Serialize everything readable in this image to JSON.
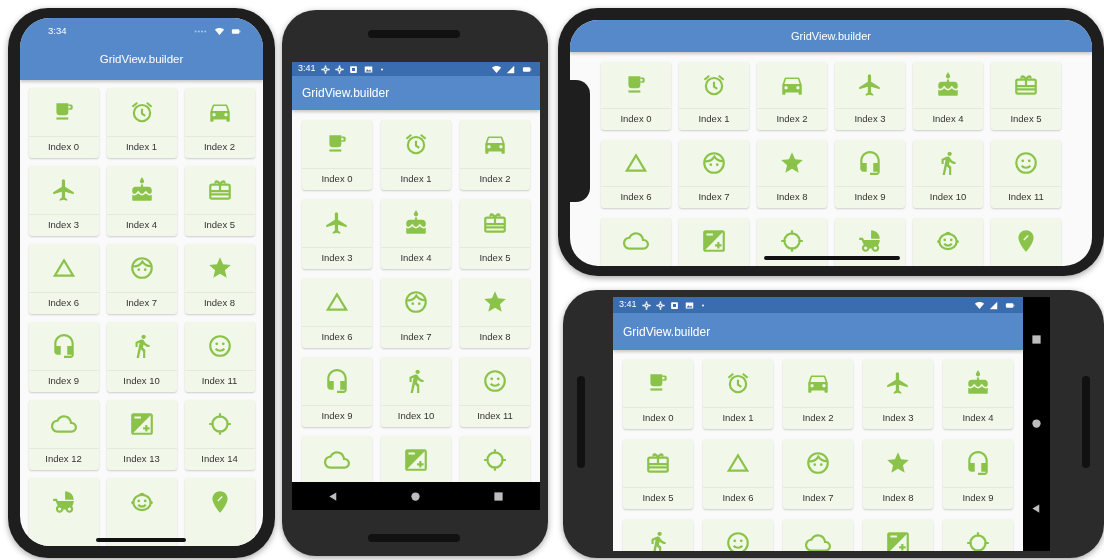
{
  "devices": [
    {
      "kind": "iphone-portrait",
      "status_bar": {
        "time": "3:34",
        "icons": [
          {
            "kind": "signal-dots"
          },
          {
            "kind": "wifi"
          },
          {
            "kind": "battery"
          }
        ]
      },
      "app_bar": {
        "title": "GridView.builder"
      },
      "tiles": [
        {
          "kind": "coffee",
          "label": "Index 0"
        },
        {
          "kind": "alarm",
          "label": "Index 1"
        },
        {
          "kind": "car",
          "label": "Index 2"
        },
        {
          "kind": "airplane",
          "label": "Index 3"
        },
        {
          "kind": "cake",
          "label": "Index 4"
        },
        {
          "kind": "gift",
          "label": "Index 5"
        },
        {
          "kind": "triangle",
          "label": "Index 6"
        },
        {
          "kind": "face",
          "label": "Index 7"
        },
        {
          "kind": "star",
          "label": "Index 8"
        },
        {
          "kind": "headset",
          "label": "Index 9"
        },
        {
          "kind": "walk",
          "label": "Index 10"
        },
        {
          "kind": "smiley",
          "label": "Index 11"
        },
        {
          "kind": "cloud",
          "label": "Index 12"
        },
        {
          "kind": "exposure",
          "label": "Index 13"
        },
        {
          "kind": "crosshair",
          "label": "Index 14"
        },
        {
          "kind": "stroller"
        },
        {
          "kind": "baby"
        },
        {
          "kind": "pin"
        }
      ]
    },
    {
      "kind": "android-portrait",
      "status_bar": {
        "time": "3:41",
        "icons": [
          {
            "kind": "gear"
          },
          {
            "kind": "gear"
          },
          {
            "kind": "square"
          },
          {
            "kind": "image"
          },
          {
            "kind": "dot"
          },
          {
            "kind": "spacer"
          },
          {
            "kind": "wifi"
          },
          {
            "kind": "signal"
          },
          {
            "kind": "battery"
          }
        ]
      },
      "app_bar": {
        "title": "GridView.builder"
      },
      "tiles": [
        {
          "kind": "coffee",
          "label": "Index 0"
        },
        {
          "kind": "alarm",
          "label": "Index 1"
        },
        {
          "kind": "car",
          "label": "Index 2"
        },
        {
          "kind": "airplane",
          "label": "Index 3"
        },
        {
          "kind": "cake",
          "label": "Index 4"
        },
        {
          "kind": "gift",
          "label": "Index 5"
        },
        {
          "kind": "triangle",
          "label": "Index 6"
        },
        {
          "kind": "face",
          "label": "Index 7"
        },
        {
          "kind": "star",
          "label": "Index 8"
        },
        {
          "kind": "headset",
          "label": "Index 9"
        },
        {
          "kind": "walk",
          "label": "Index 10"
        },
        {
          "kind": "smiley",
          "label": "Index 11"
        },
        {
          "kind": "cloud"
        },
        {
          "kind": "exposure"
        },
        {
          "kind": "crosshair"
        }
      ],
      "nav_bar": [
        {
          "kind": "back"
        },
        {
          "kind": "home"
        },
        {
          "kind": "recents"
        }
      ]
    },
    {
      "kind": "iphone-landscape",
      "app_bar": {
        "title": "GridView.builder"
      },
      "tiles": [
        {
          "kind": "coffee",
          "label": "Index 0"
        },
        {
          "kind": "alarm",
          "label": "Index 1"
        },
        {
          "kind": "car",
          "label": "Index 2"
        },
        {
          "kind": "airplane",
          "label": "Index 3"
        },
        {
          "kind": "cake",
          "label": "Index 4"
        },
        {
          "kind": "gift",
          "label": "Index 5"
        },
        {
          "kind": "triangle",
          "label": "Index 6"
        },
        {
          "kind": "face",
          "label": "Index 7"
        },
        {
          "kind": "star",
          "label": "Index 8"
        },
        {
          "kind": "headset",
          "label": "Index 9"
        },
        {
          "kind": "walk",
          "label": "Index 10"
        },
        {
          "kind": "smiley",
          "label": "Index 11"
        },
        {
          "kind": "cloud"
        },
        {
          "kind": "exposure"
        },
        {
          "kind": "crosshair"
        },
        {
          "kind": "stroller"
        },
        {
          "kind": "baby"
        },
        {
          "kind": "pin"
        }
      ]
    },
    {
      "kind": "android-landscape",
      "status_bar": {
        "time": "3:41",
        "icons": [
          {
            "kind": "gear"
          },
          {
            "kind": "gear"
          },
          {
            "kind": "square"
          },
          {
            "kind": "image"
          },
          {
            "kind": "dot"
          },
          {
            "kind": "spacer"
          },
          {
            "kind": "wifi"
          },
          {
            "kind": "signal"
          },
          {
            "kind": "battery"
          }
        ]
      },
      "app_bar": {
        "title": "GridView.builder"
      },
      "tiles": [
        {
          "kind": "coffee",
          "label": "Index 0"
        },
        {
          "kind": "alarm",
          "label": "Index 1"
        },
        {
          "kind": "car",
          "label": "Index 2"
        },
        {
          "kind": "airplane",
          "label": "Index 3"
        },
        {
          "kind": "cake",
          "label": "Index 4"
        },
        {
          "kind": "gift",
          "label": "Index 5"
        },
        {
          "kind": "triangle",
          "label": "Index 6"
        },
        {
          "kind": "face",
          "label": "Index 7"
        },
        {
          "kind": "star",
          "label": "Index 8"
        },
        {
          "kind": "headset",
          "label": "Index 9"
        },
        {
          "kind": "walk"
        },
        {
          "kind": "smiley"
        },
        {
          "kind": "cloud"
        },
        {
          "kind": "exposure"
        },
        {
          "kind": "crosshair"
        }
      ],
      "nav_bar": [
        {
          "kind": "recents"
        },
        {
          "kind": "home"
        },
        {
          "kind": "back"
        }
      ]
    }
  ]
}
